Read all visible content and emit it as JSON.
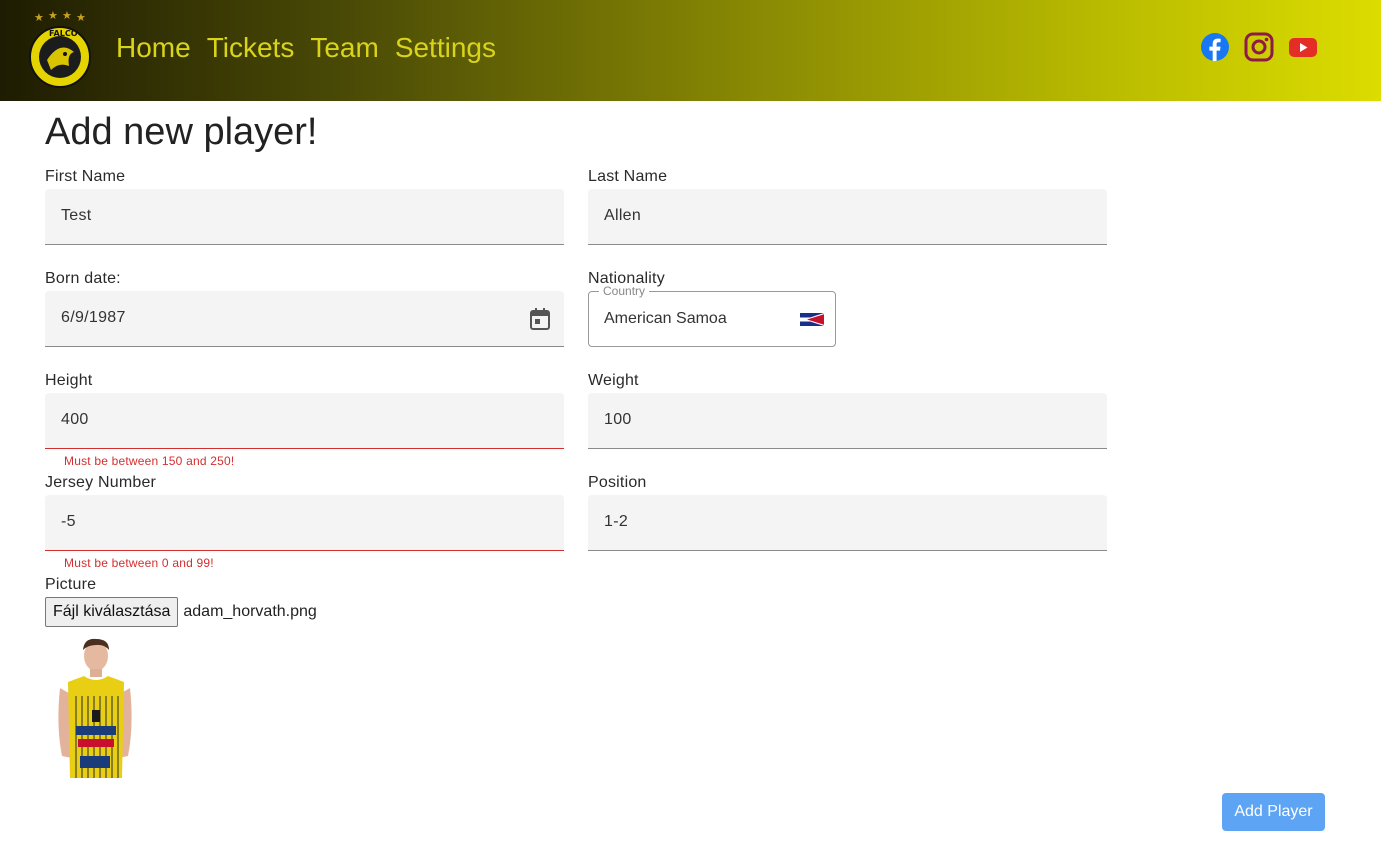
{
  "header": {
    "logo_text": "FALCO",
    "nav": [
      {
        "label": "Home"
      },
      {
        "label": "Tickets"
      },
      {
        "label": "Team"
      },
      {
        "label": "Settings"
      }
    ],
    "social": [
      "facebook-icon",
      "instagram-icon",
      "youtube-icon"
    ]
  },
  "form": {
    "title": "Add new player!",
    "first_name": {
      "label": "First Name",
      "value": "Test"
    },
    "last_name": {
      "label": "Last Name",
      "value": "Allen"
    },
    "born_date": {
      "label": "Born date:",
      "value": "6/9/1987"
    },
    "nationality": {
      "label": "Nationality",
      "legend": "Country",
      "value": "American Samoa"
    },
    "height": {
      "label": "Height",
      "value": "400",
      "error": "Must be between 150 and 250!"
    },
    "weight": {
      "label": "Weight",
      "value": "100"
    },
    "jersey": {
      "label": "Jersey Number",
      "value": "-5",
      "error": "Must be between 0 and 99!"
    },
    "position": {
      "label": "Position",
      "value": "1-2"
    },
    "picture": {
      "label": "Picture",
      "button": "Fájl kiválasztása",
      "file_name": "adam_horvath.png"
    },
    "submit": "Add Player"
  },
  "colors": {
    "nav_text": "#d9d31a",
    "error": "#d32f2f",
    "primary_button": "#5ea4f4",
    "facebook": "#1877f2",
    "instagram": "#8e1a4a",
    "youtube": "#e52d27"
  }
}
